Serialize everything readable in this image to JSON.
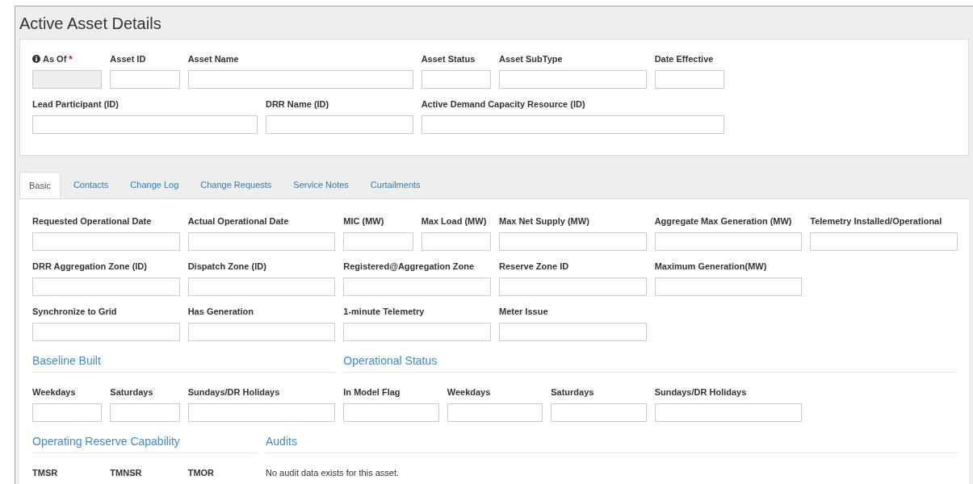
{
  "title": "Active Asset Details",
  "required_mark": "*",
  "header_fields": [
    {
      "label": "As Of",
      "required": true,
      "info": true,
      "disabled": true
    },
    {
      "label": "Asset ID",
      "required": false,
      "info": false,
      "disabled": false
    },
    {
      "label": "Asset Name",
      "required": false,
      "info": false,
      "disabled": false
    },
    {
      "label": "Asset Status",
      "required": false,
      "info": false,
      "disabled": false
    },
    {
      "label": "Asset SubType",
      "required": false,
      "info": false,
      "disabled": false
    },
    {
      "label": "Date Effective",
      "required": false,
      "info": false,
      "disabled": false
    },
    {
      "label": "Lead Participant (ID)",
      "required": false,
      "info": false,
      "disabled": false
    },
    {
      "label": "DRR Name (ID)",
      "required": false,
      "info": false,
      "disabled": false
    },
    {
      "label": "Active Demand Capacity Resource (ID)",
      "required": false,
      "info": false,
      "disabled": false
    }
  ],
  "tabs": [
    {
      "label": "Basic",
      "selected": true
    },
    {
      "label": "Contacts",
      "selected": false
    },
    {
      "label": "Change Log",
      "selected": false
    },
    {
      "label": "Change Requests",
      "selected": false
    },
    {
      "label": "Service Notes",
      "selected": false
    },
    {
      "label": "Curtailments",
      "selected": false
    }
  ],
  "basic_fields": [
    "Requested Operational Date",
    "Actual Operational Date",
    "MIC (MW)",
    "Max Load (MW)",
    "Max Net Supply (MW)",
    "Aggregate Max Generation (MW)",
    "Telemetry Installed/Operational",
    "DRR Aggregation Zone (ID)",
    "Dispatch Zone (ID)",
    "Registered@Aggregation Zone",
    "Reserve Zone ID",
    "Maximum Generation(MW)",
    "Synchronize to Grid",
    "Has Generation",
    "1-minute Telemetry",
    "Meter Issue"
  ],
  "baseline_built": {
    "heading": "Baseline Built",
    "fields": [
      "Weekdays",
      "Saturdays",
      "Sundays/DR Holidays"
    ]
  },
  "operational_status": {
    "heading": "Operational Status",
    "fields": [
      "In Model Flag",
      "Weekdays",
      "Saturdays",
      "Sundays/DR Holidays"
    ]
  },
  "operating_reserve_capability": {
    "heading": "Operating Reserve Capability",
    "fields": [
      "TMSR",
      "TMNSR",
      "TMOR"
    ]
  },
  "audits": {
    "heading": "Audits",
    "message": "No audit data exists for this asset."
  }
}
